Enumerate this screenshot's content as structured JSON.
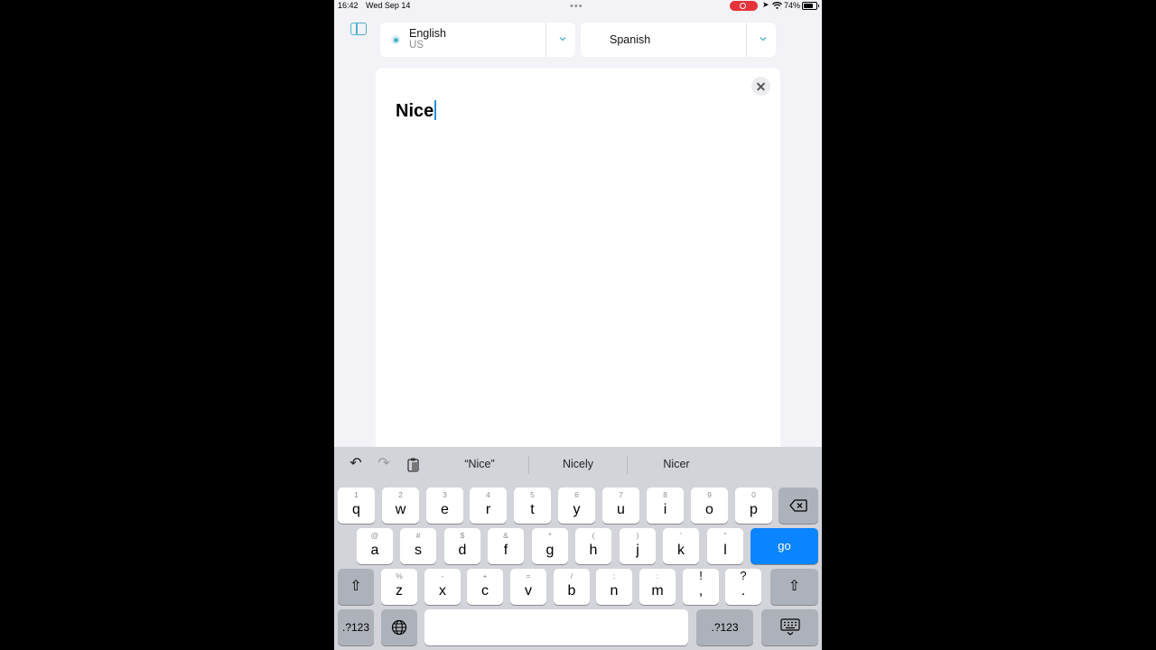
{
  "status_bar": {
    "time": "16:42",
    "date": "Wed Sep 14",
    "battery": "74%"
  },
  "source_language": {
    "name": "English",
    "region": "US"
  },
  "target_language": {
    "name": "Spanish"
  },
  "input": {
    "text": "Nice"
  },
  "suggestions": [
    "“Nice”",
    "Nicely",
    "Nicer"
  ],
  "keyboard": {
    "row1": [
      {
        "hint": "1",
        "key": "q"
      },
      {
        "hint": "2",
        "key": "w"
      },
      {
        "hint": "3",
        "key": "e"
      },
      {
        "hint": "4",
        "key": "r"
      },
      {
        "hint": "5",
        "key": "t"
      },
      {
        "hint": "6",
        "key": "y"
      },
      {
        "hint": "7",
        "key": "u"
      },
      {
        "hint": "8",
        "key": "i"
      },
      {
        "hint": "9",
        "key": "o"
      },
      {
        "hint": "0",
        "key": "p"
      }
    ],
    "row2": [
      {
        "hint": "@",
        "key": "a"
      },
      {
        "hint": "#",
        "key": "s"
      },
      {
        "hint": "$",
        "key": "d"
      },
      {
        "hint": "&",
        "key": "f"
      },
      {
        "hint": "*",
        "key": "g"
      },
      {
        "hint": "(",
        "key": "h"
      },
      {
        "hint": ")",
        "key": "j"
      },
      {
        "hint": "'",
        "key": "k"
      },
      {
        "hint": "\"",
        "key": "l"
      }
    ],
    "row3": [
      {
        "hint": "%",
        "key": "z"
      },
      {
        "hint": "-",
        "key": "x"
      },
      {
        "hint": "+",
        "key": "c"
      },
      {
        "hint": "=",
        "key": "v"
      },
      {
        "hint": "/",
        "key": "b"
      },
      {
        "hint": ";",
        "key": "n"
      },
      {
        "hint": ":",
        "key": "m"
      },
      {
        "hint": "!",
        "key": ","
      },
      {
        "hint": "?",
        "key": "."
      }
    ],
    "go_label": "go",
    "numbers_label": ".?123",
    "shift_glyph": "⇧",
    "delete_glyph": "⌫",
    "globe_glyph": "🌐",
    "undo_glyph": "↶",
    "redo_glyph": "↷"
  },
  "icons": {
    "sidebar": "sidebar-icon",
    "chevron": "chevron-down-icon",
    "clear": "close-icon",
    "paste": "clipboard-icon",
    "hide_keyboard": "keyboard-dismiss-icon"
  },
  "colors": {
    "accent": "#4fb3c9",
    "go_key": "#0a84ff",
    "record": "#e5333b"
  }
}
